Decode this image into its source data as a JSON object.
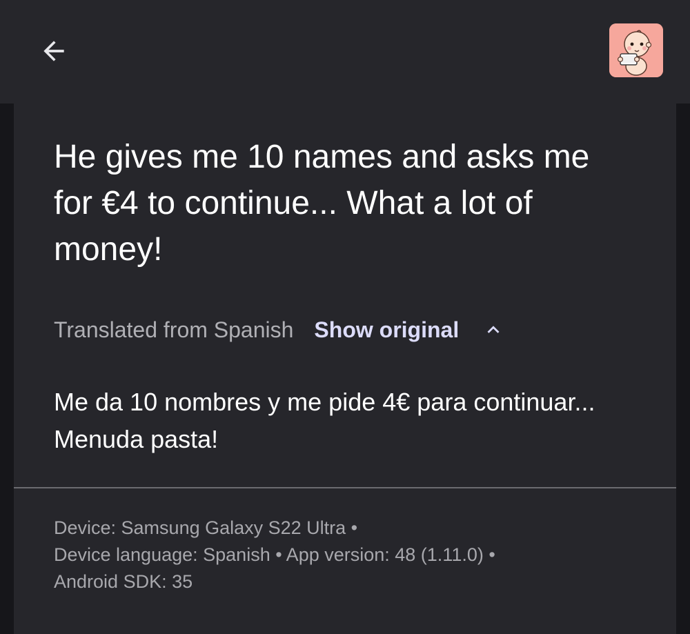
{
  "header": {
    "back_icon": "arrow-left-icon",
    "app_icon": "baby-holding-phone-app-icon",
    "app_icon_bg": "#f6a79c"
  },
  "review": {
    "translated_text": "He gives me 10 names and asks me for €4 to continue... What a lot of money!",
    "translated_from_label": "Translated from Spanish",
    "show_original_label": "Show original",
    "collapse_icon": "chevron-up-icon",
    "original_text": "Me da 10 nombres y me pide 4€ para continuar... Menuda pasta!"
  },
  "metadata": {
    "line1": "Device: Samsung Galaxy S22 Ultra •",
    "line2": "Device language: Spanish • App version: 48 (1.11.0) •",
    "line3": "Android SDK: 35"
  },
  "colors": {
    "page_background": "#16161a",
    "surface": "#26262b",
    "accent_link": "#dcdcfa",
    "divider": "#6b6b70"
  }
}
